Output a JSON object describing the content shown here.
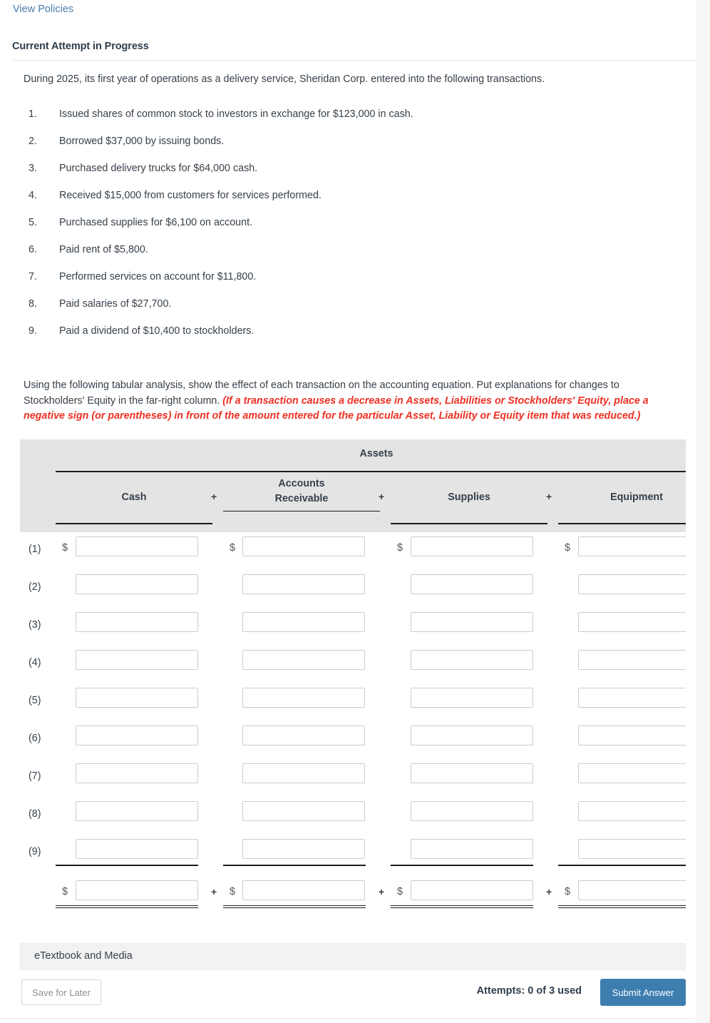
{
  "header": {
    "view_policies_label": "View Policies",
    "attempt_title": "Current Attempt in Progress"
  },
  "intro": "During 2025, its first year of operations as a delivery service, Sheridan Corp. entered into the following transactions.",
  "transactions": [
    {
      "num": "1.",
      "text": "Issued shares of common stock to investors in exchange for $123,000 in cash."
    },
    {
      "num": "2.",
      "text": "Borrowed $37,000 by issuing bonds."
    },
    {
      "num": "3.",
      "text": "Purchased delivery trucks for $64,000 cash."
    },
    {
      "num": "4.",
      "text": "Received $15,000 from customers for services performed."
    },
    {
      "num": "5.",
      "text": "Purchased supplies for $6,100 on account."
    },
    {
      "num": "6.",
      "text": "Paid rent of $5,800."
    },
    {
      "num": "7.",
      "text": "Performed services on account for $11,800."
    },
    {
      "num": "8.",
      "text": "Paid salaries of $27,700."
    },
    {
      "num": "9.",
      "text": "Paid a dividend of $10,400 to stockholders."
    }
  ],
  "instructions": {
    "normal_text": "Using the following tabular analysis, show the effect of each transaction on the accounting equation. Put explanations for changes to Stockholders' Equity in the far-right column. ",
    "warning_text": "(If a transaction causes a decrease in Assets, Liabilities or Stockholders' Equity, place a negative sign (or parentheses) in front of the amount entered for the particular Asset, Liability or Equity item that was reduced.)"
  },
  "table": {
    "group_header": "Assets",
    "columns": [
      {
        "label": "Cash",
        "line1": "Cash",
        "line2": ""
      },
      {
        "label": "Accounts Receivable",
        "line1": "Accounts",
        "line2": "Receivable"
      },
      {
        "label": "Supplies",
        "line1": "Supplies",
        "line2": ""
      },
      {
        "label": "Equipment",
        "line1": "Equipment",
        "line2": ""
      }
    ],
    "operators": [
      "+",
      "+",
      "+"
    ],
    "currency_symbol": "$",
    "row_labels": [
      "(1)",
      "(2)",
      "(3)",
      "(4)",
      "(5)",
      "(6)",
      "(7)",
      "(8)",
      "(9)"
    ],
    "cell_values": [
      [
        "",
        "",
        "",
        ""
      ],
      [
        "",
        "",
        "",
        ""
      ],
      [
        "",
        "",
        "",
        ""
      ],
      [
        "",
        "",
        "",
        ""
      ],
      [
        "",
        "",
        "",
        ""
      ],
      [
        "",
        "",
        "",
        ""
      ],
      [
        "",
        "",
        "",
        ""
      ],
      [
        "",
        "",
        "",
        ""
      ],
      [
        "",
        "",
        "",
        ""
      ]
    ],
    "total_values": [
      "",
      "",
      "",
      ""
    ]
  },
  "footer": {
    "etextbook_label": "eTextbook and Media",
    "save_label": "Save for Later",
    "attempts_label": "Attempts: 0 of 3 used",
    "submit_label": "Submit Answer"
  },
  "colors": {
    "link": "#4a7dab",
    "warning": "#ee3124",
    "submit_button": "#3d7eaf",
    "table_header_bg": "#e4e4e4",
    "text": "#36404a"
  }
}
